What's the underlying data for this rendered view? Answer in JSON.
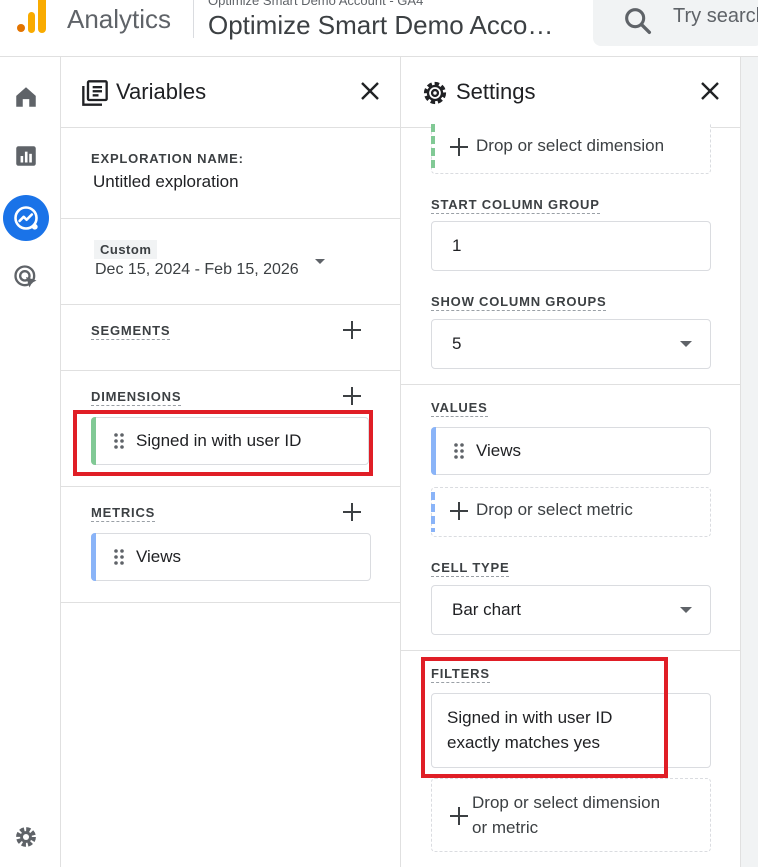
{
  "header": {
    "app_name": "Analytics",
    "account_sub": "Optimize Smart Demo Account - GA4",
    "account_main": "Optimize Smart Demo Acco…",
    "search_placeholder": "Try search"
  },
  "rail": {
    "items": [
      {
        "icon": "home-icon",
        "active": false
      },
      {
        "icon": "reports-icon",
        "active": false
      },
      {
        "icon": "explore-icon",
        "active": true
      },
      {
        "icon": "advertising-icon",
        "active": false
      },
      {
        "icon": "settings-gear-icon",
        "active": false
      }
    ]
  },
  "variables": {
    "title": "Variables",
    "exploration_label": "EXPLORATION NAME:",
    "exploration_name": "Untitled exploration",
    "date_preset": "Custom",
    "date_range": "Dec 15, 2024 - Feb 15, 2026",
    "segments_label": "SEGMENTS",
    "dimensions_label": "DIMENSIONS",
    "dimensions": [
      "Signed in with user ID"
    ],
    "metrics_label": "METRICS",
    "metrics": [
      "Views"
    ]
  },
  "settings": {
    "title": "Settings",
    "drop_dimension": "Drop or select dimension",
    "start_column_group_label": "START COLUMN GROUP",
    "start_column_group_value": "1",
    "show_column_groups_label": "SHOW COLUMN GROUPS",
    "show_column_groups_value": "5",
    "values_label": "VALUES",
    "values": [
      "Views"
    ],
    "drop_metric": "Drop or select metric",
    "cell_type_label": "CELL TYPE",
    "cell_type_value": "Bar chart",
    "filters_label": "FILTERS",
    "filter_line1": "Signed in with user ID",
    "filter_line2": "exactly matches yes",
    "drop_dim_or_metric_1": "Drop or select dimension",
    "drop_dim_or_metric_2": "or metric"
  },
  "colors": {
    "accent_blue": "#1a73e8",
    "dimension_green": "#81c995",
    "metric_blue": "#8ab4f8",
    "highlight_red": "#e01e26",
    "logo_orange": "#f9ab00",
    "logo_dark_orange": "#e37400"
  }
}
